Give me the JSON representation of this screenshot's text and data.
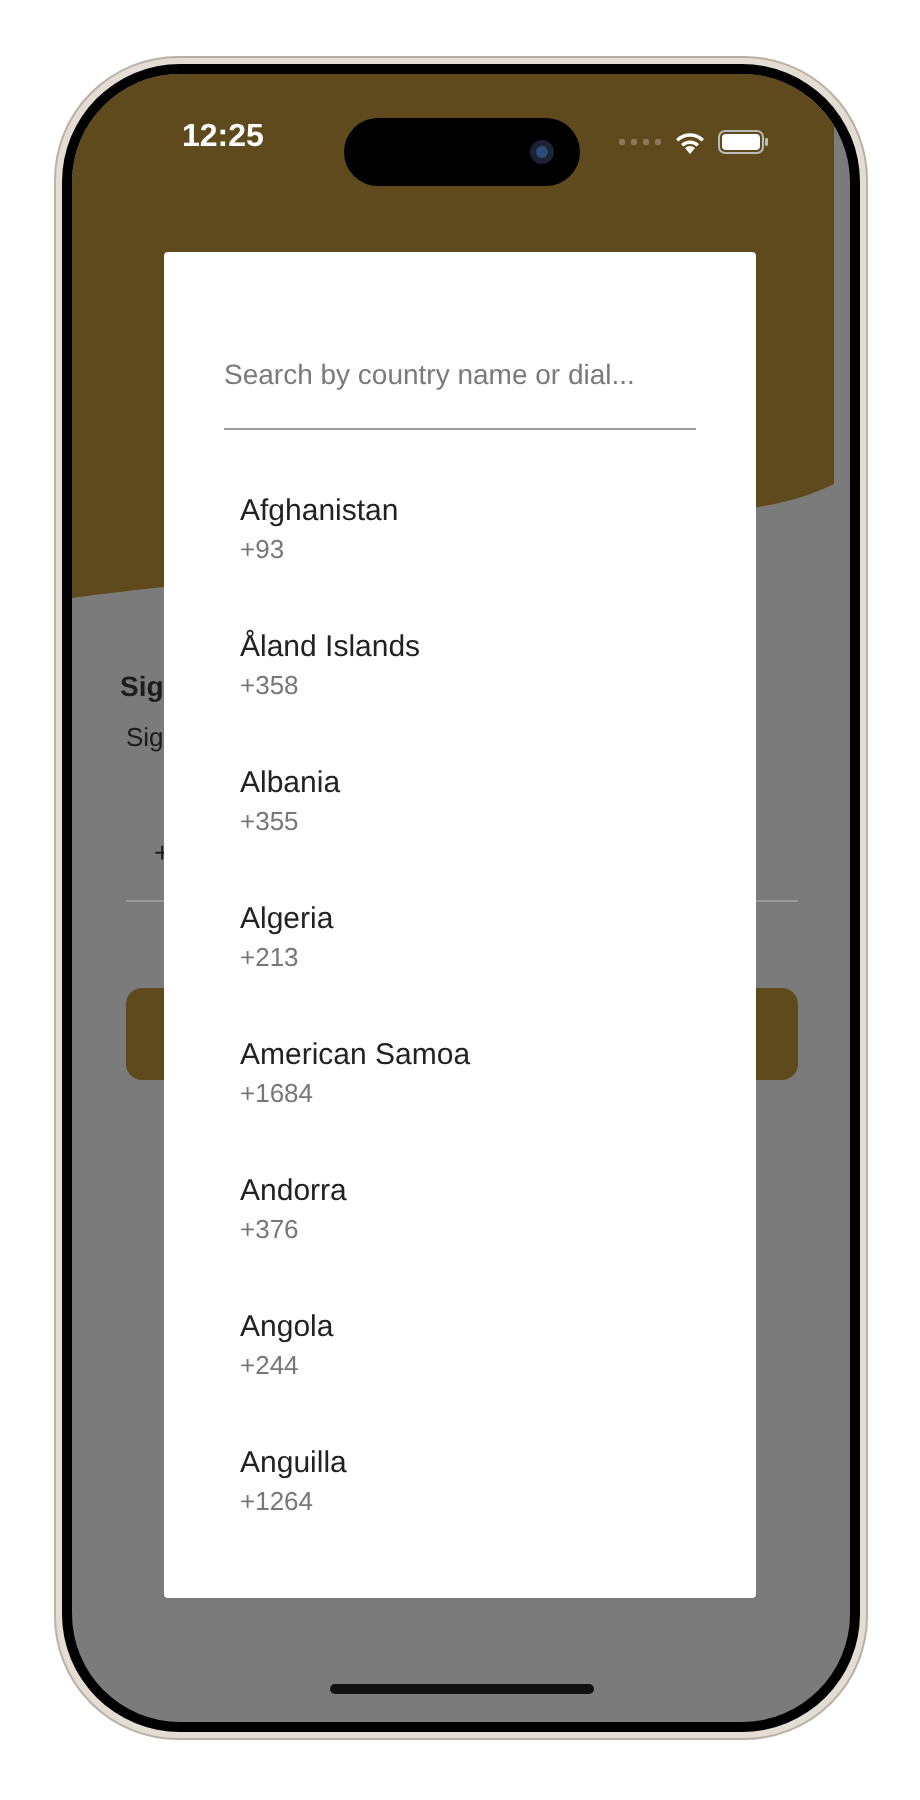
{
  "status_bar": {
    "time": "12:25"
  },
  "background": {
    "title": "Sig",
    "subtitle": "Sig",
    "phone_prefix": "+"
  },
  "dialog": {
    "search": {
      "placeholder": "Search by country name or dial..."
    },
    "countries": [
      {
        "name": "Afghanistan",
        "dial_code": "+93"
      },
      {
        "name": "Åland Islands",
        "dial_code": "+358"
      },
      {
        "name": "Albania",
        "dial_code": "+355"
      },
      {
        "name": "Algeria",
        "dial_code": "+213"
      },
      {
        "name": "American Samoa",
        "dial_code": "+1684"
      },
      {
        "name": "Andorra",
        "dial_code": "+376"
      },
      {
        "name": "Angola",
        "dial_code": "+244"
      },
      {
        "name": "Anguilla",
        "dial_code": "+1264"
      }
    ]
  }
}
